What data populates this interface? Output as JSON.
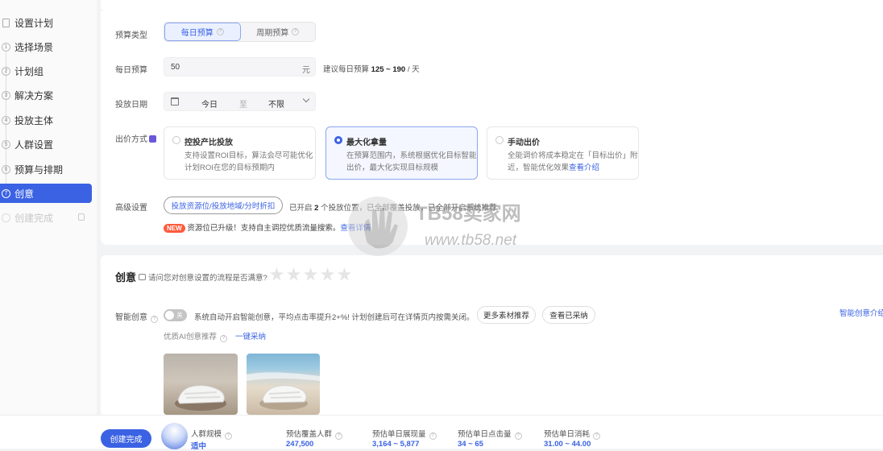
{
  "sidebar": {
    "items": [
      {
        "label": "设置计划",
        "num": ""
      },
      {
        "label": "选择场景",
        "num": "1"
      },
      {
        "label": "计划组",
        "num": "2"
      },
      {
        "label": "解决方案",
        "num": "3"
      },
      {
        "label": "投放主体",
        "num": "4"
      },
      {
        "label": "人群设置",
        "num": "5"
      },
      {
        "label": "预算与排期",
        "num": "6"
      },
      {
        "label": "创意",
        "num": "7"
      },
      {
        "label": "创建完成",
        "num": ""
      }
    ]
  },
  "budget_type": {
    "label": "预算类型",
    "options": [
      "每日预算",
      "周期预算"
    ],
    "selected": "每日预算"
  },
  "daily_budget": {
    "label": "每日预算",
    "value": "50",
    "unit": "元",
    "hint_prefix": "建议每日预算",
    "hint_range": "125 ~ 190",
    "hint_suffix": "/ 天"
  },
  "schedule": {
    "label": "投放日期",
    "start": "今日",
    "sep": "至",
    "end": "不限"
  },
  "bid": {
    "label": "出价方式",
    "options": [
      {
        "title": "控投产比投放",
        "desc": [
          "支持设置ROI目标，算法会尽可能优化",
          "计划ROI在您的目标预期内"
        ]
      },
      {
        "title": "最大化拿量",
        "desc": [
          "在预算范围内，系统根据优化目标智能",
          "出价，最大化实现目标规模"
        ]
      },
      {
        "title": "手动出价",
        "desc": [
          "全能调价将成本稳定在「目标出价」附",
          "近，智能优化效果"
        ],
        "link": "查看介绍"
      }
    ]
  },
  "advanced": {
    "label": "高级设置",
    "button": "投放资源位/投放地域/分时折扣",
    "status_prefix": "已开启",
    "status_count": "2",
    "status_suffix": "个投放位置，已全部覆盖投放，已全部开启系统推荐",
    "new_badge": "NEW",
    "notice": "资源位已升级！支持自主调控优质流量搜索。",
    "notice_link": "查看详情"
  },
  "creative": {
    "title": "创意",
    "survey": "请问您对创意设置的流程是否满意?",
    "smart_label": "智能创意",
    "toggle_text": "关",
    "smart_desc": "系统自动开启智能创意，平均点击率提升2+%! 计划创建后可在详情页内按需关闭。",
    "btn_more": "更多素材推荐",
    "btn_adopted": "查看已采纳",
    "intro_link": "智能创意介绍",
    "ai_label": "优质AI创意推荐",
    "ai_link": "一键采纳"
  },
  "bottom": {
    "create_button": "创建完成",
    "audience_label": "人群规模",
    "audience_value": "适中",
    "stats": [
      {
        "label": "预估覆盖人群",
        "value": "247,500"
      },
      {
        "label": "预估单日展现量",
        "value": "3,164 ~ 5,877"
      },
      {
        "label": "预估单日点击量",
        "value": "34 ~ 65"
      },
      {
        "label": "预估单日消耗",
        "value": "31.00 ~ 44.00"
      }
    ]
  },
  "watermark": {
    "title": "TB58卖家网",
    "url": "www.tb58.net"
  }
}
